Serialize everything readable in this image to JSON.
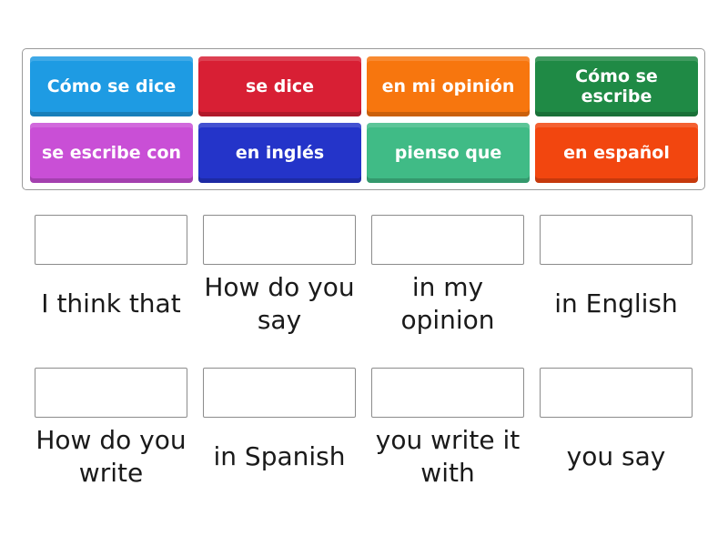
{
  "tiles": [
    {
      "label": "Cómo se dice",
      "color": "#1e9be3"
    },
    {
      "label": "se dice",
      "color": "#d81f34"
    },
    {
      "label": "en mi opinión",
      "color": "#f7760e"
    },
    {
      "label": "Cómo se escribe",
      "color": "#1f8a45"
    },
    {
      "label": "se escribe con",
      "color": "#c94fd6"
    },
    {
      "label": "en inglés",
      "color": "#2434c9"
    },
    {
      "label": "pienso que",
      "color": "#40bb86"
    },
    {
      "label": "en español",
      "color": "#f2460f"
    }
  ],
  "targets": [
    {
      "clue": "I think that"
    },
    {
      "clue": "How do you say"
    },
    {
      "clue": "in my opinion"
    },
    {
      "clue": "in English"
    },
    {
      "clue": "How do you write"
    },
    {
      "clue": "in Spanish"
    },
    {
      "clue": "you write it with"
    },
    {
      "clue": "you say"
    }
  ]
}
